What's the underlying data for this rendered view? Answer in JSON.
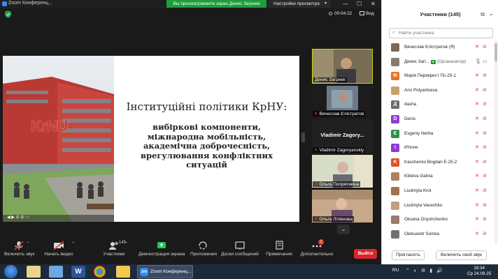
{
  "window": {
    "app_title": "Zoom Конференц...",
    "share_banner": "Вы просматриваете экран Денис Загрнек",
    "view_settings": "Настройки просмотра",
    "timer": "00:04:22",
    "view_label": "Вид"
  },
  "slide": {
    "title": "Інституційні політики КрНУ:",
    "bullets": [
      "вибіркові компоненти,",
      "міжнародна мобільність,",
      "академічна доброчесність,",
      "врегулювання конфліктних",
      "ситуацій"
    ],
    "building_sign": "KrNU"
  },
  "tiles": [
    {
      "name": "Денис Загрнек",
      "muted": false
    },
    {
      "name": "Вячеслав Єлістратов",
      "muted": true
    },
    {
      "name": "Vladimir Zagoryanskiy",
      "big_name": "Vladimir Zagory...",
      "muted": true
    },
    {
      "name": "Ольга Попрятикіна",
      "muted": true
    },
    {
      "name": "Ольга Літвінова",
      "muted": true
    }
  ],
  "toolbar": {
    "unmute": "Включить звук",
    "start_video": "Начать видео",
    "participants": "Участники",
    "participants_count": "145",
    "share": "Демонстрация экрана",
    "apps": "Приложения",
    "whiteboards": "Доски сообщений",
    "notes": "Примечания",
    "more": "Дополнительно",
    "more_badge": "1",
    "end": "Выйти"
  },
  "panel": {
    "title": "Участники (145)",
    "search_placeholder": "Найти участника",
    "participants": [
      {
        "name": "Вячеслав Єлістратов (Я)",
        "initial": "",
        "color": "#7a6a5a",
        "role": "",
        "host": false
      },
      {
        "name": "Денис Загі...",
        "initial": "",
        "color": "#8a7a6a",
        "role": "(Организатор)",
        "host": true
      },
      {
        "name": "Марія Перекрест Пс-25-1",
        "initial": "М",
        "color": "#e8702a",
        "role": "",
        "host": false
      },
      {
        "name": "Ann Polyantseva",
        "initial": "",
        "color": "#c9a070",
        "role": "",
        "host": false
      },
      {
        "name": "dasha",
        "initial": "Д",
        "color": "#6b6b6b",
        "role": "",
        "host": false
      },
      {
        "name": "Denis",
        "initial": "D",
        "color": "#8a3fd1",
        "role": "",
        "host": false
      },
      {
        "name": "Evgeniy Nerba",
        "initial": "E",
        "color": "#2f8f4a",
        "role": "",
        "host": false
      },
      {
        "name": "iPhone",
        "initial": "I",
        "color": "#8a3fd1",
        "role": "",
        "host": false
      },
      {
        "name": "Kaschenko Bogdan Е-25-2",
        "initial": "K",
        "color": "#e0502a",
        "role": "",
        "host": false
      },
      {
        "name": "Kikteva Galina",
        "initial": "",
        "color": "#b08060",
        "role": "",
        "host": false
      },
      {
        "name": "Liudmyla Krot",
        "initial": "",
        "color": "#a07050",
        "role": "",
        "host": false
      },
      {
        "name": "Liudmyla Vasechko",
        "initial": "",
        "color": "#c0a080",
        "role": "",
        "host": false
      },
      {
        "name": "Oksana Onyshchenko",
        "initial": "",
        "color": "#9a7a6a",
        "role": "",
        "host": false
      },
      {
        "name": "Oleksandr Somka",
        "initial": "",
        "color": "#707070",
        "role": "",
        "host": false
      }
    ],
    "invite": "Пригласить",
    "unmute_self": "Включить свой звук"
  },
  "taskbar": {
    "zoom_task": "Zoom Конференц...",
    "zoom_logo": "zm",
    "lang": "RU",
    "time": "16:34",
    "date": "Ср 24.09.25"
  }
}
